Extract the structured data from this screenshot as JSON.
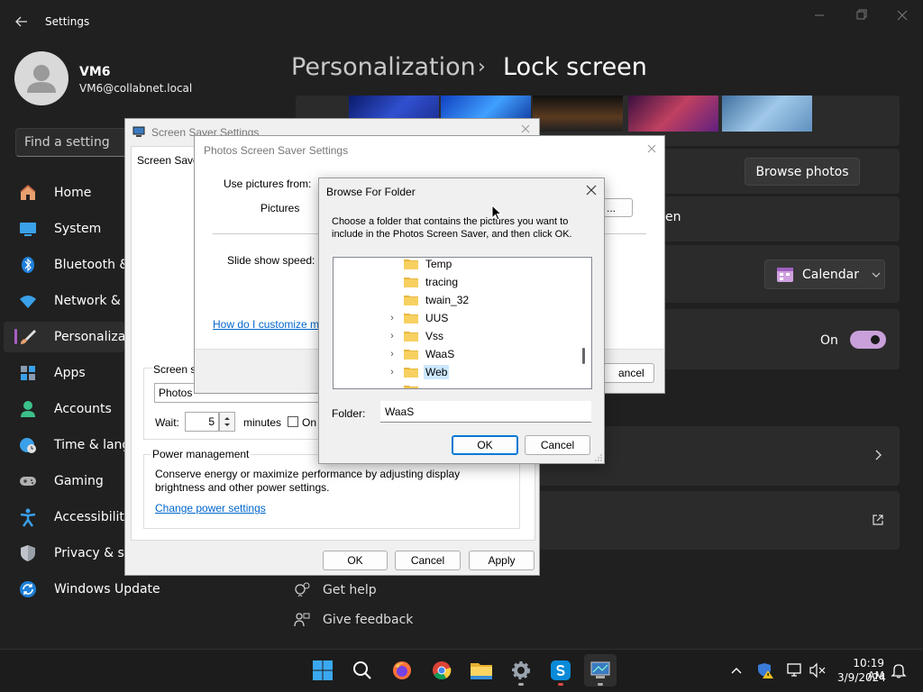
{
  "window": {
    "title": "Settings"
  },
  "user": {
    "name": "VM6",
    "email": "VM6@collabnet.local"
  },
  "search": {
    "placeholder": "Find a setting"
  },
  "nav": [
    {
      "label": "Home",
      "icon": "home-icon"
    },
    {
      "label": "System",
      "icon": "monitor-icon"
    },
    {
      "label": "Bluetooth &",
      "icon": "bluetooth-icon"
    },
    {
      "label": "Network & in",
      "icon": "wifi-icon"
    },
    {
      "label": "Personalizati",
      "icon": "brush-icon"
    },
    {
      "label": "Apps",
      "icon": "apps-icon"
    },
    {
      "label": "Accounts",
      "icon": "person-icon"
    },
    {
      "label": "Time & langu",
      "icon": "clock-globe-icon"
    },
    {
      "label": "Gaming",
      "icon": "gamepad-icon"
    },
    {
      "label": "Accessibility",
      "icon": "accessibility-icon"
    },
    {
      "label": "Privacy & sec",
      "icon": "shield-icon"
    },
    {
      "label": "Windows Update",
      "icon": "update-icon"
    }
  ],
  "breadcrumb": {
    "parent": "Personalization",
    "separator": "›",
    "current": "Lock screen"
  },
  "lock_screen": {
    "browse_photos": "Browse photos",
    "partial_en": "en",
    "calendar_label": "Calendar",
    "toggle_label": "On",
    "toggle_on": true
  },
  "help": {
    "get_help": "Get help",
    "give_feedback": "Give feedback"
  },
  "screen_saver_dialog": {
    "title": "Screen Saver Settings",
    "tab_partial": "Screen Saver",
    "group_partial": "Screen sa",
    "selected": "Photos",
    "wait_label": "Wait:",
    "wait_value": "5",
    "minutes_label": "minutes",
    "on_label": "On",
    "power_title": "Power management",
    "power_text": "Conserve energy or maximize performance by adjusting display brightness and other power settings.",
    "power_link": "Change power settings",
    "ok": "OK",
    "cancel": "Cancel",
    "apply": "Apply"
  },
  "photos_dialog": {
    "title": "Photos Screen Saver Settings",
    "use_pictures": "Use pictures from:",
    "pictures": "Pictures",
    "browse_partial": "...",
    "speed_label": "Slide show speed:",
    "help_link": "How do I customize m",
    "cancel_partial": "ancel"
  },
  "browse_dialog": {
    "title": "Browse For Folder",
    "instructions": "Choose a folder that contains the pictures you want to include in the Photos Screen Saver, and then click OK.",
    "folders": [
      {
        "name": "Temp",
        "expandable": false,
        "selected": false
      },
      {
        "name": "tracing",
        "expandable": false,
        "selected": false
      },
      {
        "name": "twain_32",
        "expandable": false,
        "selected": false
      },
      {
        "name": "UUS",
        "expandable": true,
        "selected": false
      },
      {
        "name": "Vss",
        "expandable": true,
        "selected": false
      },
      {
        "name": "WaaS",
        "expandable": true,
        "selected": false
      },
      {
        "name": "Web",
        "expandable": true,
        "selected": true
      }
    ],
    "folder_label": "Folder:",
    "folder_value": "WaaS",
    "ok": "OK",
    "cancel": "Cancel"
  },
  "taskbar": {
    "time": "10:19 AM",
    "date": "3/9/2024"
  }
}
